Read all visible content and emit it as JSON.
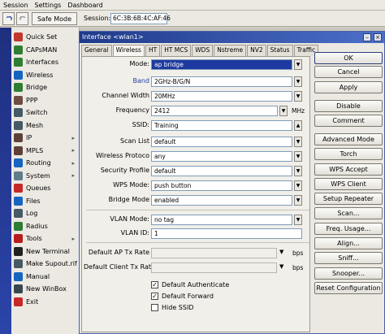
{
  "menubar": {
    "items": [
      "Session",
      "Settings",
      "Dashboard"
    ]
  },
  "toolbar": {
    "undo_icon": "undo-icon",
    "redo_icon": "redo-icon",
    "safe_mode_label": "Safe Mode",
    "session_label": "Session:",
    "session_value": "6C:3B:6B:4C:AF:46"
  },
  "sidebar": {
    "items": [
      {
        "label": "Quick Set",
        "icon": "quick-set-icon",
        "color": "#c0392b"
      },
      {
        "label": "CAPsMAN",
        "icon": "capsman-icon",
        "color": "#2e7d32"
      },
      {
        "label": "Interfaces",
        "icon": "interfaces-icon",
        "color": "#2e7d32"
      },
      {
        "label": "Wireless",
        "icon": "wireless-icon",
        "color": "#1565c0"
      },
      {
        "label": "Bridge",
        "icon": "bridge-icon",
        "color": "#2e7d32"
      },
      {
        "label": "PPP",
        "icon": "ppp-icon",
        "color": "#6d4c41"
      },
      {
        "label": "Switch",
        "icon": "switch-icon",
        "color": "#455a64"
      },
      {
        "label": "Mesh",
        "icon": "mesh-icon",
        "color": "#455a64"
      },
      {
        "label": "IP",
        "icon": "ip-icon",
        "color": "#5d4037",
        "submenu": true
      },
      {
        "label": "MPLS",
        "icon": "mpls-icon",
        "color": "#5d4037",
        "submenu": true
      },
      {
        "label": "Routing",
        "icon": "routing-icon",
        "color": "#1565c0",
        "submenu": true
      },
      {
        "label": "System",
        "icon": "system-icon",
        "color": "#607d8b",
        "submenu": true
      },
      {
        "label": "Queues",
        "icon": "queues-icon",
        "color": "#c62828"
      },
      {
        "label": "Files",
        "icon": "files-icon",
        "color": "#1565c0"
      },
      {
        "label": "Log",
        "icon": "log-icon",
        "color": "#455a64"
      },
      {
        "label": "Radius",
        "icon": "radius-icon",
        "color": "#2e7d32"
      },
      {
        "label": "Tools",
        "icon": "tools-icon",
        "color": "#b71c1c",
        "submenu": true
      },
      {
        "label": "New Terminal",
        "icon": "terminal-icon",
        "color": "#212121"
      },
      {
        "label": "Make Supout.rif",
        "icon": "supout-icon",
        "color": "#455a64"
      },
      {
        "label": "Manual",
        "icon": "manual-icon",
        "color": "#1565c0"
      },
      {
        "label": "New WinBox",
        "icon": "winbox-icon",
        "color": "#37474f"
      },
      {
        "label": "Exit",
        "icon": "exit-icon",
        "color": "#c62828"
      }
    ]
  },
  "window": {
    "title": "Interface <wlan1>",
    "tabs": [
      "General",
      "Wireless",
      "HT",
      "HT MCS",
      "WDS",
      "Nstreme",
      "NV2",
      "Status",
      "Traffic"
    ],
    "active_tab": "Wireless"
  },
  "form": {
    "mode": {
      "label": "Mode:",
      "value": "ap bridge"
    },
    "band": {
      "label": "Band",
      "value": "2GHz-B/G/N"
    },
    "channel_width": {
      "label": "Channel Width",
      "value": "20MHz"
    },
    "frequency": {
      "label": "Frequency",
      "value": "2412",
      "unit": "MHz"
    },
    "ssid": {
      "label": "SSID:",
      "value": "Training"
    },
    "scan_list": {
      "label": "Scan List",
      "value": "default"
    },
    "wireless_protocol": {
      "label": "Wireless Protoco",
      "value": "any"
    },
    "security_profile": {
      "label": "Security Profile",
      "value": "default"
    },
    "wps_mode": {
      "label": "WPS Mode:",
      "value": "push button"
    },
    "bridge_mode": {
      "label": "Bridge Mode",
      "value": "enabled"
    },
    "vlan_mode": {
      "label": "VLAN Mode:",
      "value": "no tag"
    },
    "vlan_id": {
      "label": "VLAN ID:",
      "value": "1"
    },
    "default_ap_tx_rate": {
      "label": "Default AP Tx Rate",
      "value": "",
      "unit": "bps"
    },
    "default_client_tx_rate": {
      "label": "Default Client Tx Rat",
      "value": "",
      "unit": "bps"
    },
    "default_authenticate": {
      "label": "Default Authenticate",
      "checked": true
    },
    "default_forward": {
      "label": "Default Forward",
      "checked": true
    },
    "hide_ssid": {
      "label": "Hide SSID",
      "checked": false
    }
  },
  "buttons": [
    "OK",
    "Cancel",
    "Apply",
    "Disable",
    "Comment",
    "Advanced Mode",
    "Torch",
    "WPS Accept",
    "WPS Client",
    "Setup Repeater",
    "Scan...",
    "Freq. Usage...",
    "Align...",
    "Sniff...",
    "Snooper...",
    "Reset Configuration"
  ],
  "colors": {
    "title_bar": "#1e3a8a",
    "selection": "#1e3aa0",
    "band_label": "#1f3fa8"
  }
}
